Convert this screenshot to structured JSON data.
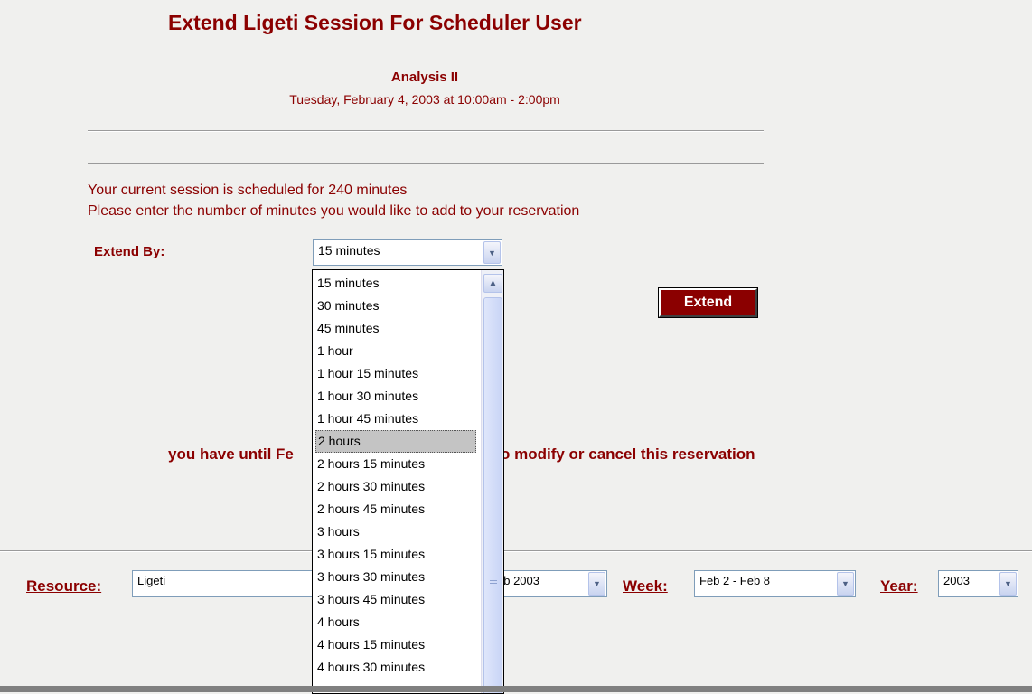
{
  "title": "Extend Ligeti Session For Scheduler User",
  "session": {
    "name": "Analysis II",
    "time": "Tuesday, February 4, 2003 at 10:00am - 2:00pm"
  },
  "messages": {
    "current": "Your current session is scheduled for 240 minutes",
    "prompt": "Please enter the number of minutes you would like to add to your reservation"
  },
  "extend": {
    "label": "Extend By:",
    "selected": "15 minutes",
    "button_label": "Extend",
    "highlighted_option": "2 hours",
    "options": [
      "15 minutes",
      "30 minutes",
      "45 minutes",
      "1 hour",
      "1 hour 15 minutes",
      "1 hour 30 minutes",
      "1 hour 45 minutes",
      "2 hours",
      "2 hours 15 minutes",
      "2 hours 30 minutes",
      "2 hours 45 minutes",
      "3 hours",
      "3 hours 15 minutes",
      "3 hours 30 minutes",
      "3 hours 45 minutes",
      "4 hours",
      "4 hours 15 minutes",
      "4 hours 30 minutes"
    ]
  },
  "deadline": {
    "text_start": "you have until Fe",
    "text_end": "0 am to modify or cancel this reservation"
  },
  "nav": {
    "resource_label": "Resource:",
    "resource_value": "Ligeti",
    "month_value": "eb 2003",
    "week_label": "Week:",
    "week_value": "Feb 2 - Feb 8",
    "year_label": "Year:",
    "year_value": "2003"
  },
  "colors": {
    "accent": "#8b0000",
    "page_bg": "#f0f0ee",
    "highlight": "#c4c4c4"
  },
  "icons": {
    "dropdown_arrow": "chevron-down-icon",
    "scroll_up": "chevron-up-icon"
  }
}
